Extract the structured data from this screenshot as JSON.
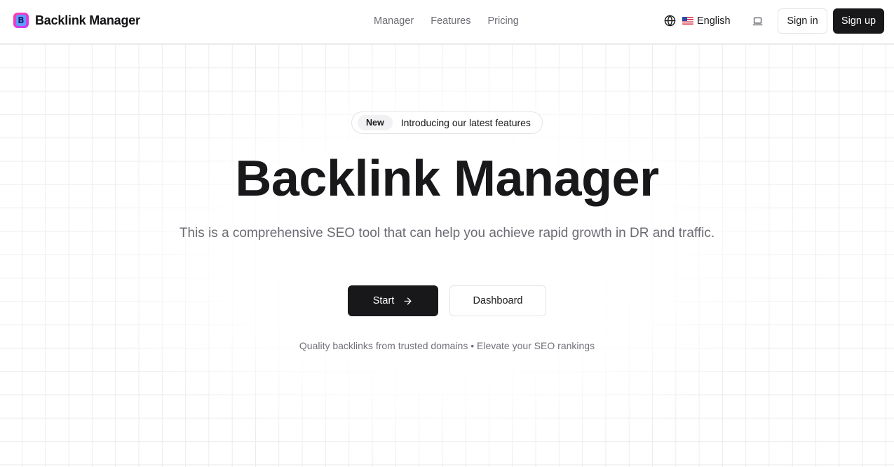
{
  "header": {
    "brand_name": "Backlink Manager",
    "nav": [
      "Manager",
      "Features",
      "Pricing"
    ],
    "language": "English",
    "signin_label": "Sign in",
    "signup_label": "Sign up"
  },
  "hero": {
    "badge_label": "New",
    "badge_text": "Introducing our latest features",
    "title": "Backlink Manager",
    "subtitle": "This is a comprehensive SEO tool that can help you achieve rapid growth in DR and traffic.",
    "start_label": "Start",
    "dashboard_label": "Dashboard",
    "tagline": "Quality backlinks from trusted domains • Elevate your SEO rankings"
  },
  "icons": {
    "logo": "backlink-manager-logo",
    "language": "globe-icon",
    "flag": "us-flag-icon",
    "theme": "laptop-icon",
    "start": "arrow-right-icon"
  },
  "colors": {
    "primary": "#18181b",
    "muted_text": "#6b6b73",
    "border": "#e4e4e7",
    "logo_gradient_start": "#ff3fa4",
    "logo_gradient_end": "#c13bff",
    "logo_inner": "#5b9dff"
  }
}
